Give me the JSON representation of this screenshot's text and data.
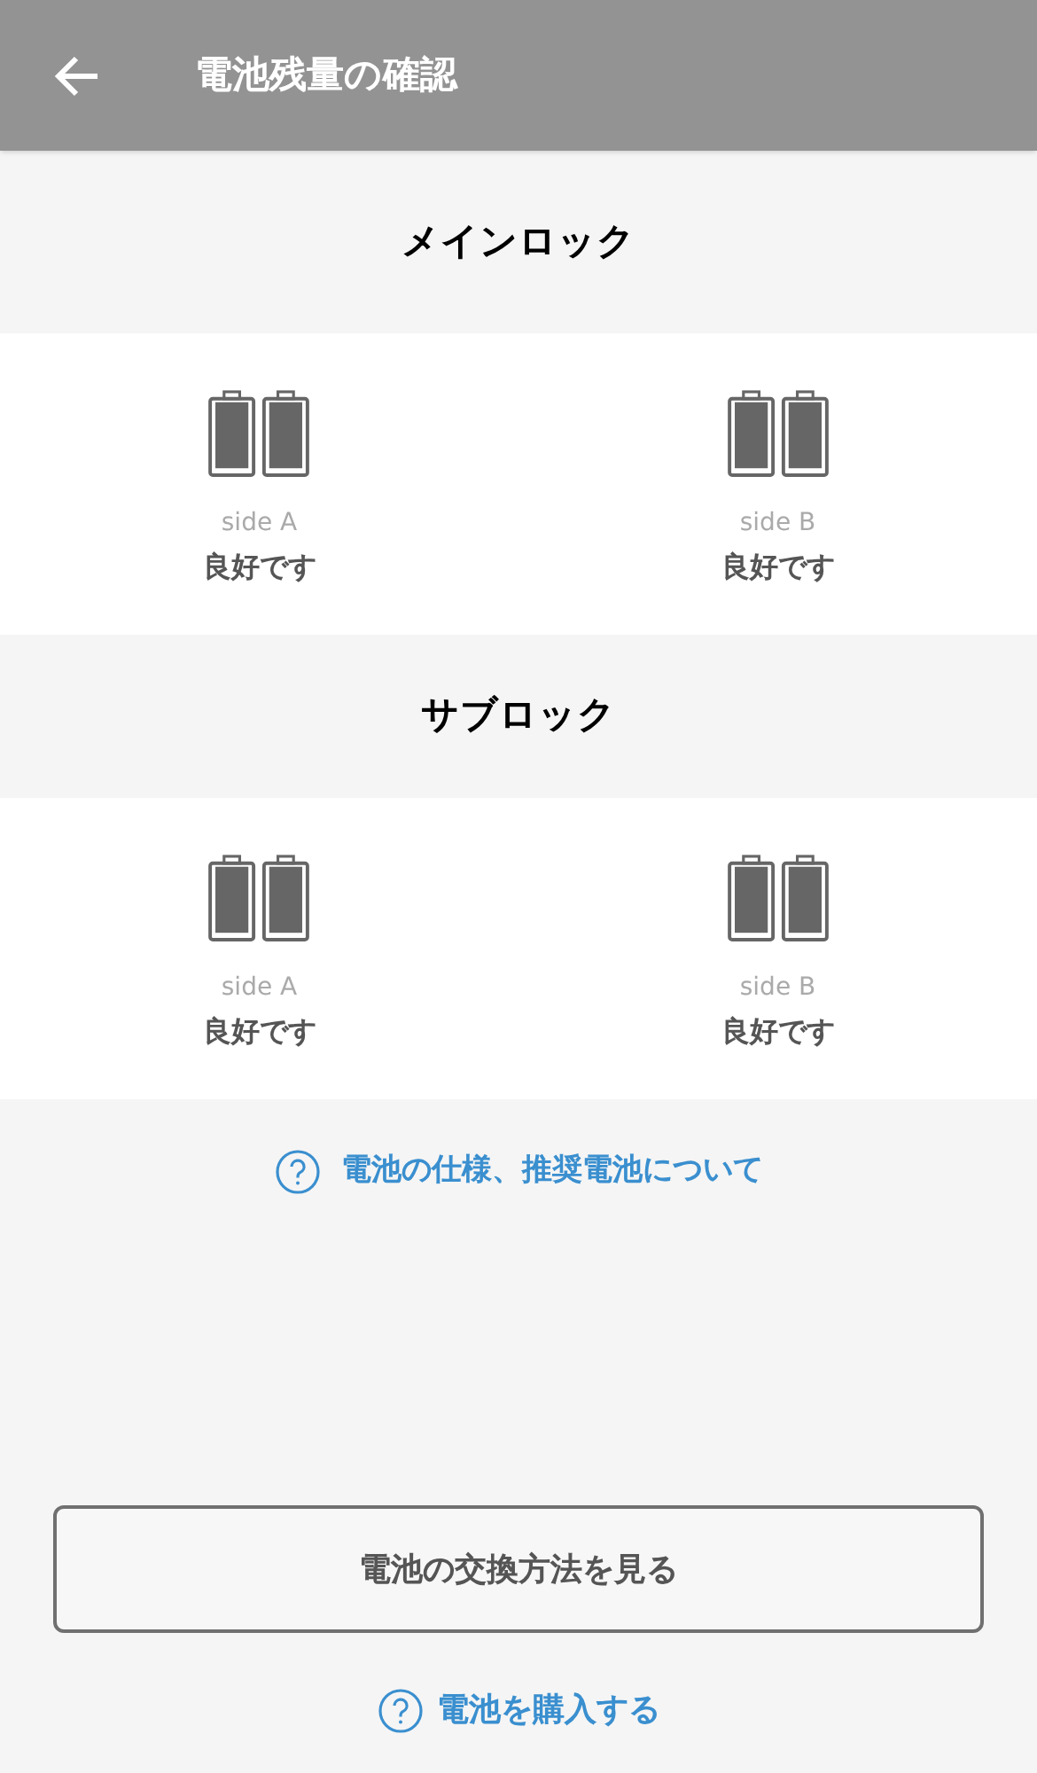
{
  "header": {
    "title": "電池残量の確認"
  },
  "locks": [
    {
      "title": "メインロック",
      "sides": [
        {
          "label": "side A",
          "status": "良好です"
        },
        {
          "label": "side B",
          "status": "良好です"
        }
      ]
    },
    {
      "title": "サブロック",
      "sides": [
        {
          "label": "side A",
          "status": "良好です"
        },
        {
          "label": "side B",
          "status": "良好です"
        }
      ]
    }
  ],
  "spec_link": "電池の仕様、推奨電池について",
  "replace_button": "電池の交換方法を見る",
  "buy_link": "電池を購入する"
}
